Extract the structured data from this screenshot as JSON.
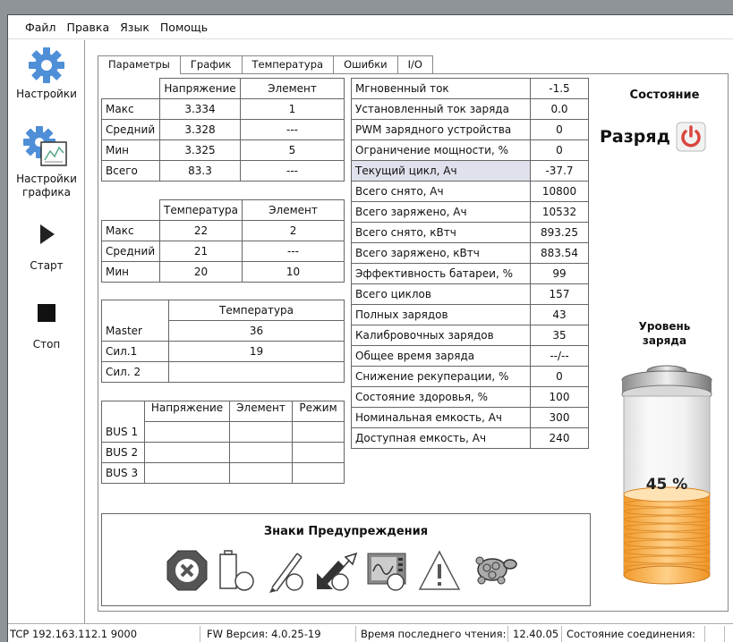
{
  "menu": [
    "Файл",
    "Правка",
    "Язык",
    "Помощь"
  ],
  "sidebar": {
    "settings": "Настройки",
    "graph_settings_line1": "Настройки",
    "graph_settings_line2": "графика",
    "start": "Старт",
    "stop": "Стоп"
  },
  "tabs": [
    "Параметры",
    "График",
    "Температура",
    "Ошибки",
    "I/O"
  ],
  "voltage_table": {
    "headers": [
      "",
      "Напряжение",
      "Элемент"
    ],
    "rows": [
      [
        "Макс",
        "3.334",
        "1"
      ],
      [
        "Средний",
        "3.328",
        "---"
      ],
      [
        "Мин",
        "3.325",
        "5"
      ],
      [
        "Всего",
        "83.3",
        "---"
      ]
    ]
  },
  "temp_table": {
    "headers": [
      "",
      "Температура",
      "Элемент"
    ],
    "rows": [
      [
        "Макс",
        "22",
        "2"
      ],
      [
        "Средний",
        "21",
        "---"
      ],
      [
        "Мин",
        "20",
        "10"
      ]
    ]
  },
  "master_table": {
    "header": "Температура",
    "rows": [
      [
        "Master",
        "36"
      ],
      [
        "Сил.1",
        "19"
      ],
      [
        "Сил. 2",
        ""
      ]
    ]
  },
  "bus_table": {
    "headers": [
      "",
      "Напряжение",
      "Элемент",
      "Режим"
    ],
    "rows": [
      [
        "BUS 1",
        "",
        "",
        ""
      ],
      [
        "BUS 2",
        "",
        "",
        ""
      ],
      [
        "BUS 3",
        "",
        "",
        ""
      ]
    ]
  },
  "params": [
    [
      "Мгновенный ток",
      "-1.5"
    ],
    [
      "Установленный ток заряда",
      "0.0"
    ],
    [
      "PWM зарядного устройства",
      "0"
    ],
    [
      "Ограничение мощности, %",
      "0"
    ],
    [
      "Текущий цикл, Ач",
      "-37.7"
    ],
    [
      "Всего снято, Ач",
      "10800"
    ],
    [
      "Всего заряжено, Ач",
      "10532"
    ],
    [
      "Всего снято, кВтч",
      "893.25"
    ],
    [
      "Всего заряжено, кВтч",
      "883.54"
    ],
    [
      "Эффективность батареи, %",
      "99"
    ],
    [
      "Всего циклов",
      "157"
    ],
    [
      "Полных зарядов",
      "43"
    ],
    [
      "Калибровочных зарядов",
      "35"
    ],
    [
      "Общее время заряда",
      "--/--"
    ],
    [
      "Снижение рекуперации, %",
      "0"
    ],
    [
      "Состояние здоровья, %",
      "100"
    ],
    [
      "Номинальная емкость, Ач",
      "300"
    ],
    [
      "Доступная емкость, Ач",
      "240"
    ]
  ],
  "state": {
    "title": "Состояние",
    "value": "Разряд"
  },
  "charge": {
    "title_line1": "Уровень",
    "title_line2": "заряда",
    "percent_label": "45 %",
    "level": 0.45
  },
  "warnings": {
    "title": "Знаки Предупреждения",
    "icons": [
      "error-octagon-icon",
      "battery-cell-icon",
      "pencil-icon",
      "regeneration-arrows-icon",
      "oscilloscope-icon",
      "warning-triangle-icon",
      "turtle-icon"
    ]
  },
  "statusbar": {
    "connection": "TCP 192.163.112.1 9000",
    "fw": "FW Версия: 4.0.25-19",
    "last_read_label": "Время последнего чтения:",
    "last_read_time": "12.40.05",
    "conn_state_label": "Состояние соединения:"
  },
  "colors": {
    "gear": "#4f8fd8",
    "battery_fill": "#f5a843",
    "power_red": "#d9463e",
    "highlight": "#dfe2ec"
  }
}
